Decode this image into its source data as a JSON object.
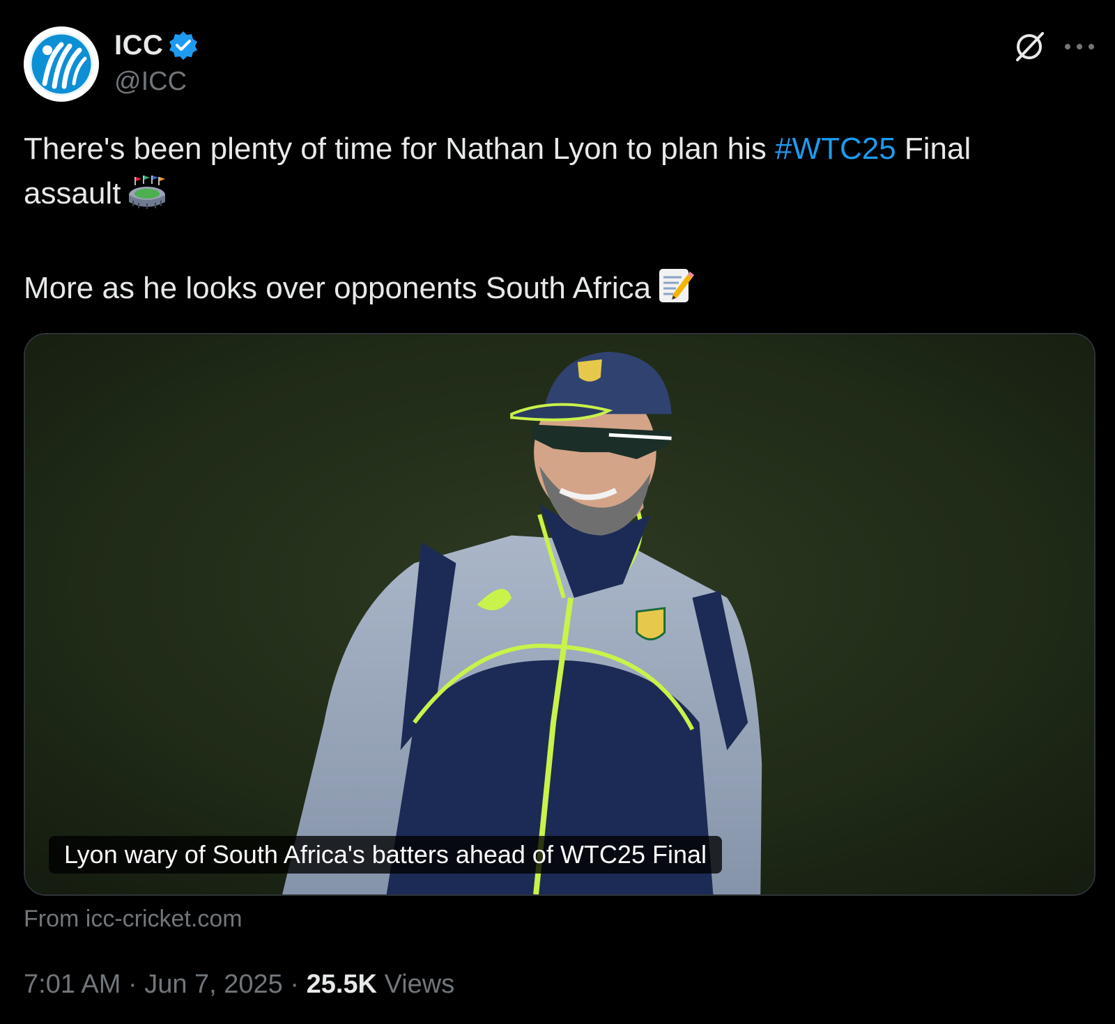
{
  "author": {
    "display_name": "ICC",
    "handle": "@ICC",
    "verified": true,
    "verified_color": "#1d9bf0"
  },
  "tweet": {
    "line1_before": "There's been plenty of time for Nathan Lyon to plan his ",
    "hashtag": "#WTC25",
    "line1_after": " Final",
    "line2": "assault",
    "line3": "More as he looks over opponents South Africa",
    "emoji_1": "stadium-emoji",
    "emoji_2": "memo-emoji",
    "hashtag_color": "#1d9bf0"
  },
  "card": {
    "caption": "Lyon wary of South Africa's batters ahead of WTC25 Final",
    "source": "From icc-cricket.com"
  },
  "meta": {
    "time": "7:01 AM",
    "separator": "·",
    "date": "Jun 7, 2025",
    "views_count": "25.5K",
    "views_label": "Views"
  },
  "icons": {
    "grok": "grok-icon",
    "more": "more-icon"
  }
}
